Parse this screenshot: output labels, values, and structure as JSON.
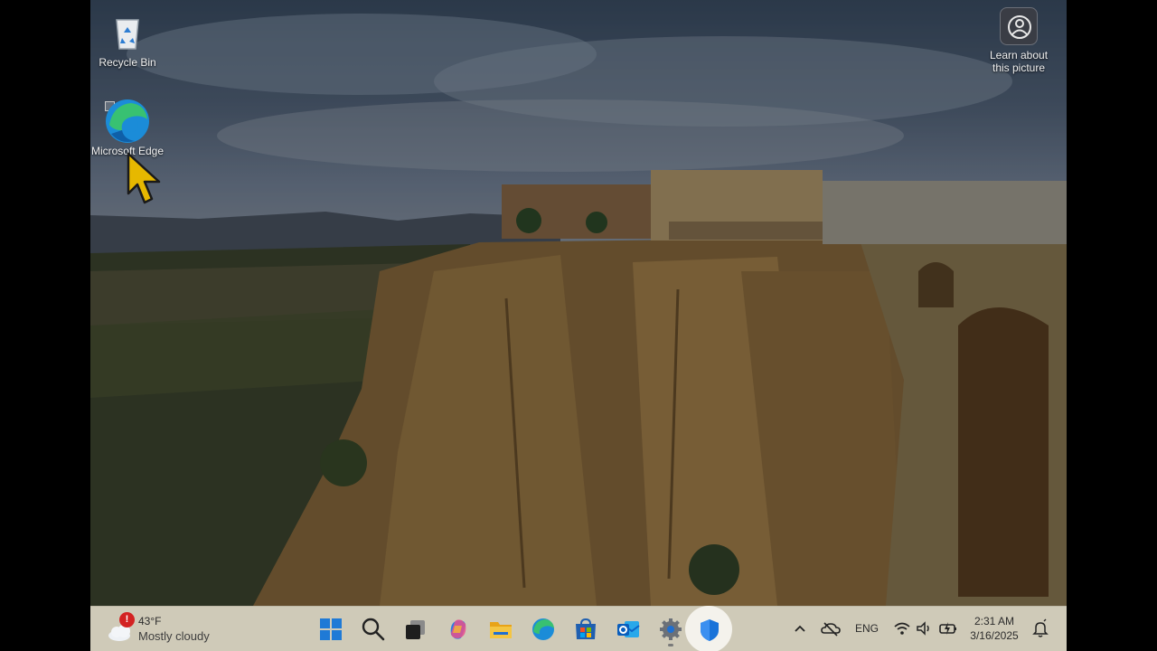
{
  "desktop": {
    "icons": [
      {
        "label": "Recycle Bin",
        "icon": "recycle-bin-icon"
      },
      {
        "label": "Microsoft Edge",
        "icon": "edge-icon"
      }
    ],
    "learn_label": "Learn about this picture"
  },
  "taskbar": {
    "weather": {
      "temp": "43°F",
      "condition": "Mostly cloudy",
      "badge": "!"
    },
    "apps": [
      {
        "name": "Start",
        "icon": "windows-start-icon"
      },
      {
        "name": "Search",
        "icon": "search-icon"
      },
      {
        "name": "Task View",
        "icon": "task-view-icon"
      },
      {
        "name": "Copilot",
        "icon": "copilot-icon"
      },
      {
        "name": "File Explorer",
        "icon": "folder-icon"
      },
      {
        "name": "Microsoft Edge",
        "icon": "edge-icon"
      },
      {
        "name": "Microsoft Store",
        "icon": "store-icon"
      },
      {
        "name": "Outlook",
        "icon": "outlook-icon"
      },
      {
        "name": "Settings",
        "icon": "gear-icon"
      },
      {
        "name": "Windows Security",
        "icon": "shield-icon"
      }
    ],
    "tray": {
      "language": "ENG",
      "time": "2:31 AM",
      "date": "3/16/2025"
    }
  },
  "colors": {
    "taskbar_bg": "#cfcab8",
    "accent_blue": "#0a64c8",
    "badge_red": "#d32222"
  }
}
